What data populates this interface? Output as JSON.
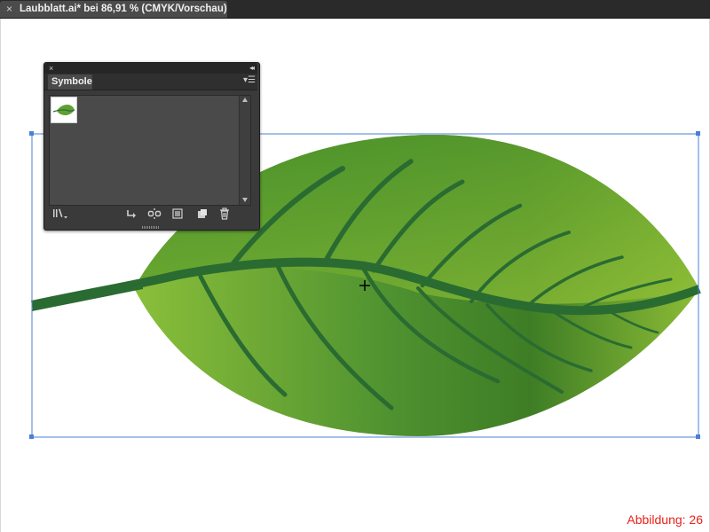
{
  "document_tab": {
    "close_glyph": "×",
    "title": "Laubblatt.ai* bei 86,91 % (CMYK/Vorschau)"
  },
  "symbols_panel": {
    "close_glyph": "×",
    "collapse_glyph": "◂◂",
    "tab_label": "Symbole",
    "menu_glyph": "▾☰",
    "symbols": [
      {
        "name": "leaf-symbol-thumbnail",
        "icon": "leaf-icon"
      }
    ],
    "toolbar_icons": [
      "symbol-libraries-menu-icon",
      "place-symbol-instance-icon",
      "break-link-icon",
      "symbol-options-icon",
      "new-symbol-icon",
      "delete-symbol-icon"
    ]
  },
  "colors": {
    "leaf_light": "#8bbf3a",
    "leaf_dark": "#3e7d25",
    "vein": "#2a6b32",
    "selection": "#4a7fd6",
    "caption": "#e8211b"
  },
  "caption": "Abbildung: 26"
}
